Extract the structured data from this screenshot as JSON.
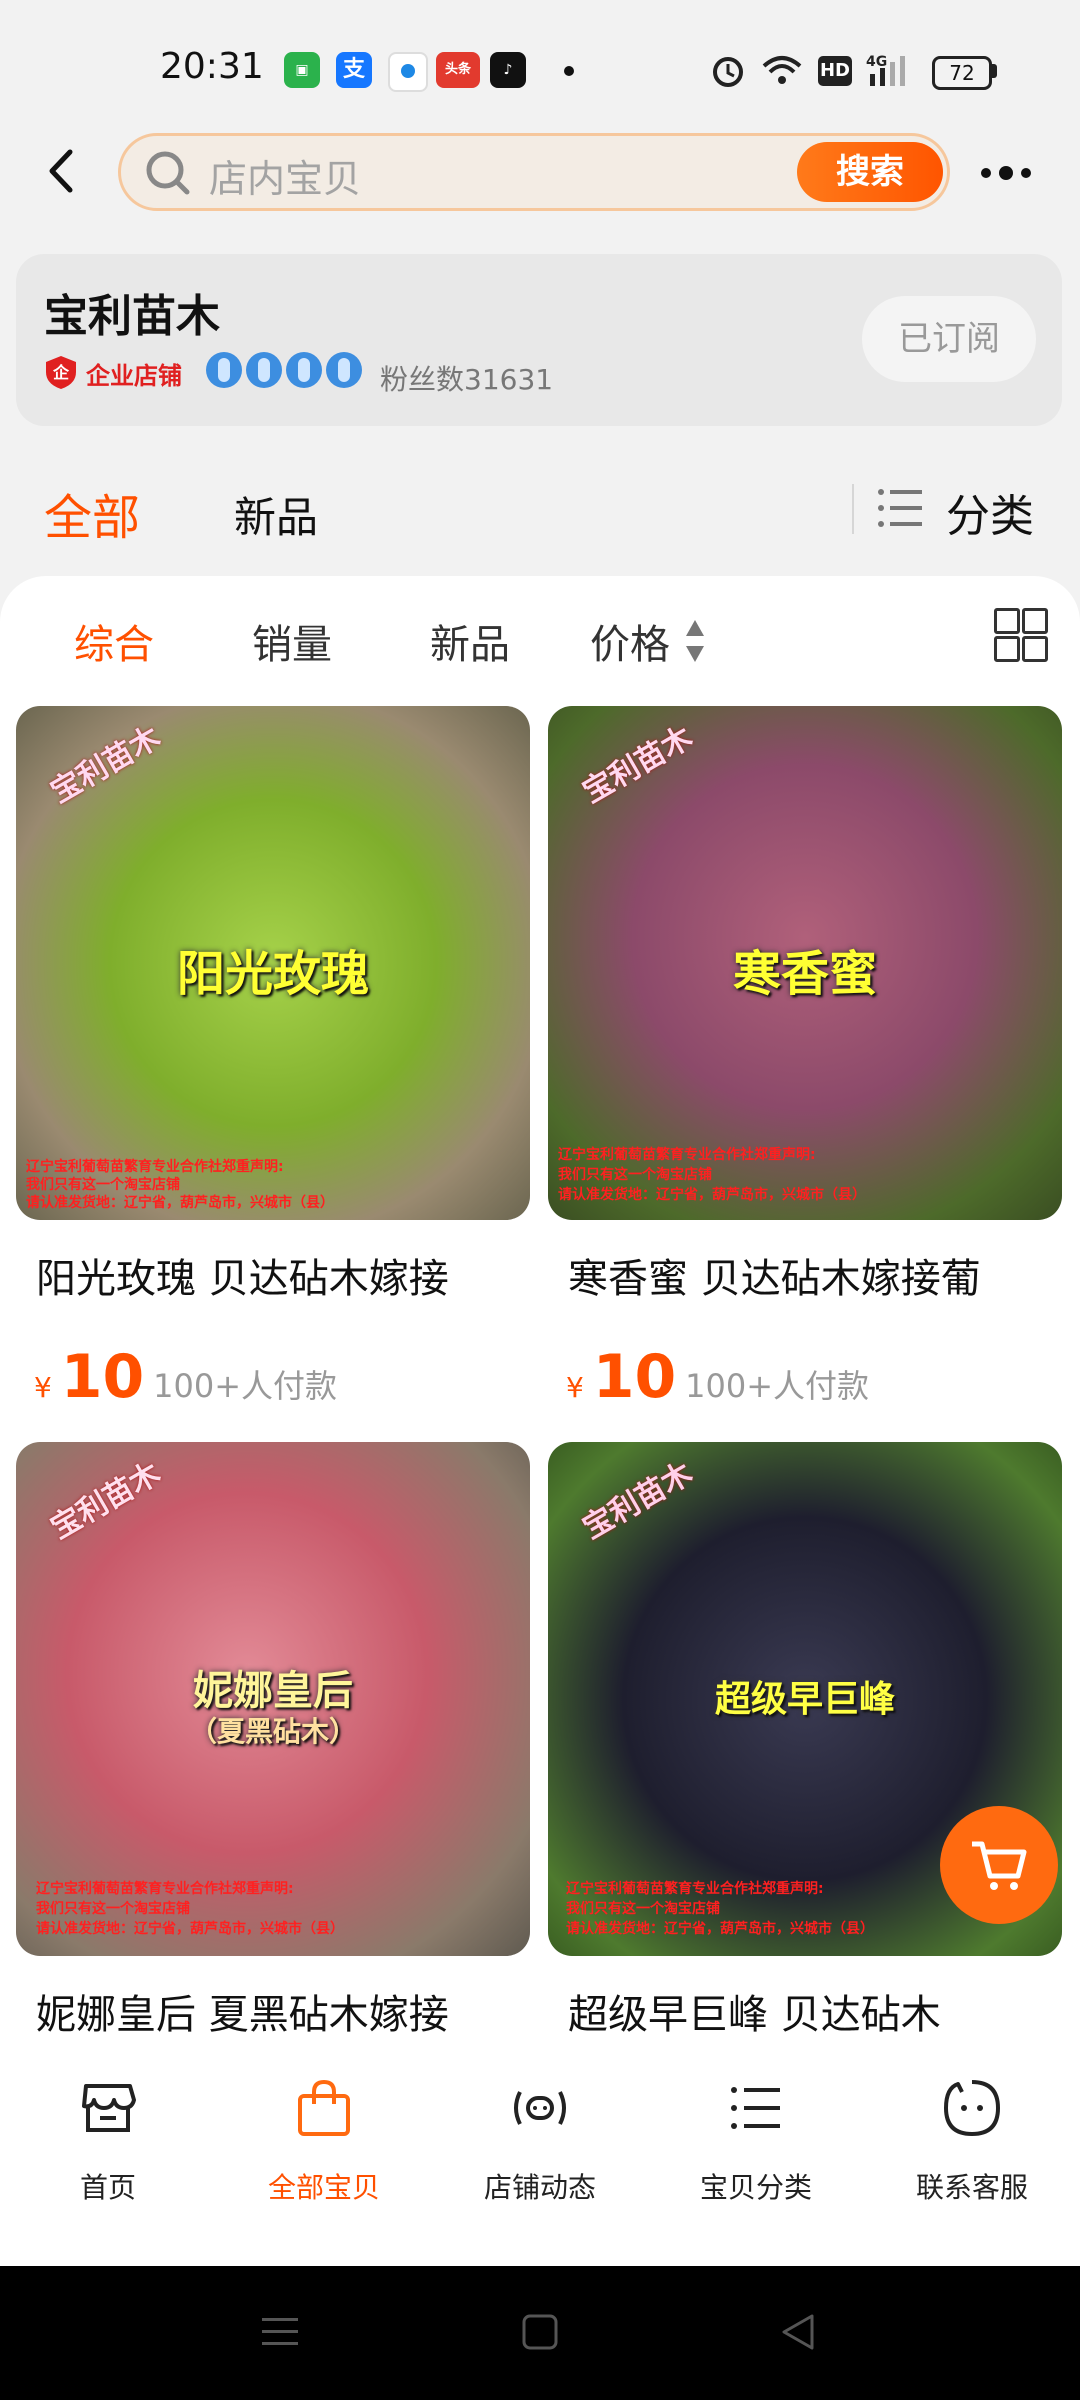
{
  "status_bar": {
    "time": "20:31",
    "apps": [
      "支",
      "头条"
    ],
    "battery": "72"
  },
  "header": {
    "search_placeholder": "店内宝贝",
    "search_button": "搜索"
  },
  "store": {
    "name": "宝利苗木",
    "badge": "企业店铺",
    "fans": "粉丝数31631",
    "subscribe": "已订阅"
  },
  "tabs": {
    "all": "全部",
    "new": "新品",
    "category": "分类"
  },
  "sort": {
    "composite": "综合",
    "sales": "销量",
    "new": "新品",
    "price": "价格"
  },
  "products": [
    {
      "title": "阳光玫瑰 贝达砧木嫁接",
      "overlay": "阳光玫瑰",
      "watermark": "宝利苗木",
      "price_symbol": "¥",
      "price": "10",
      "paid": "100+人付款",
      "color": "#8fbf3a",
      "notice": [
        "辽宁宝利葡萄苗繁育专业合作社郑重声明:",
        "我们只有这一个淘宝店铺",
        "请认准发货地：辽宁省，葫芦岛市，兴城市（县）"
      ]
    },
    {
      "title": "寒香蜜 贝达砧木嫁接葡",
      "overlay": "寒香蜜",
      "watermark": "宝利苗木",
      "price_symbol": "¥",
      "price": "10",
      "paid": "100+人付款",
      "color": "#8c4a6a",
      "notice": [
        "辽宁宝利葡萄苗繁育专业合作社郑重声明:",
        "我们只有这一个淘宝店铺",
        "请认准发货地：辽宁省，葫芦岛市，兴城市（县）"
      ]
    },
    {
      "title": "妮娜皇后 夏黑砧木嫁接",
      "overlay": "妮娜皇后",
      "overlay2": "（夏黑砧木）",
      "watermark": "宝利苗木",
      "color": "#c85a6a",
      "notice": [
        "辽宁宝利葡萄苗繁育专业合作社郑重声明:",
        "我们只有这一个淘宝店铺",
        "请认准发货地：辽宁省，葫芦岛市，兴城市（县）"
      ]
    },
    {
      "title": "超级早巨峰   贝达砧木",
      "overlay": "超级早巨峰",
      "watermark": "宝利苗木",
      "color": "#1e1e2e",
      "notice": [
        "辽宁宝利葡萄苗繁育专业合作社郑重声明:",
        "我们只有这一个淘宝店铺",
        "请认准发货地：辽宁省，葫芦岛市，兴城市（县）"
      ]
    }
  ],
  "bottom_nav": [
    {
      "label": "首页",
      "icon": "store-icon"
    },
    {
      "label": "全部宝贝",
      "icon": "bag-icon"
    },
    {
      "label": "店铺动态",
      "icon": "broadcast-icon"
    },
    {
      "label": "宝贝分类",
      "icon": "list-icon"
    },
    {
      "label": "联系客服",
      "icon": "chat-icon"
    }
  ],
  "colors": {
    "accent": "#ff5000",
    "nav_active": "#ff6a10"
  }
}
